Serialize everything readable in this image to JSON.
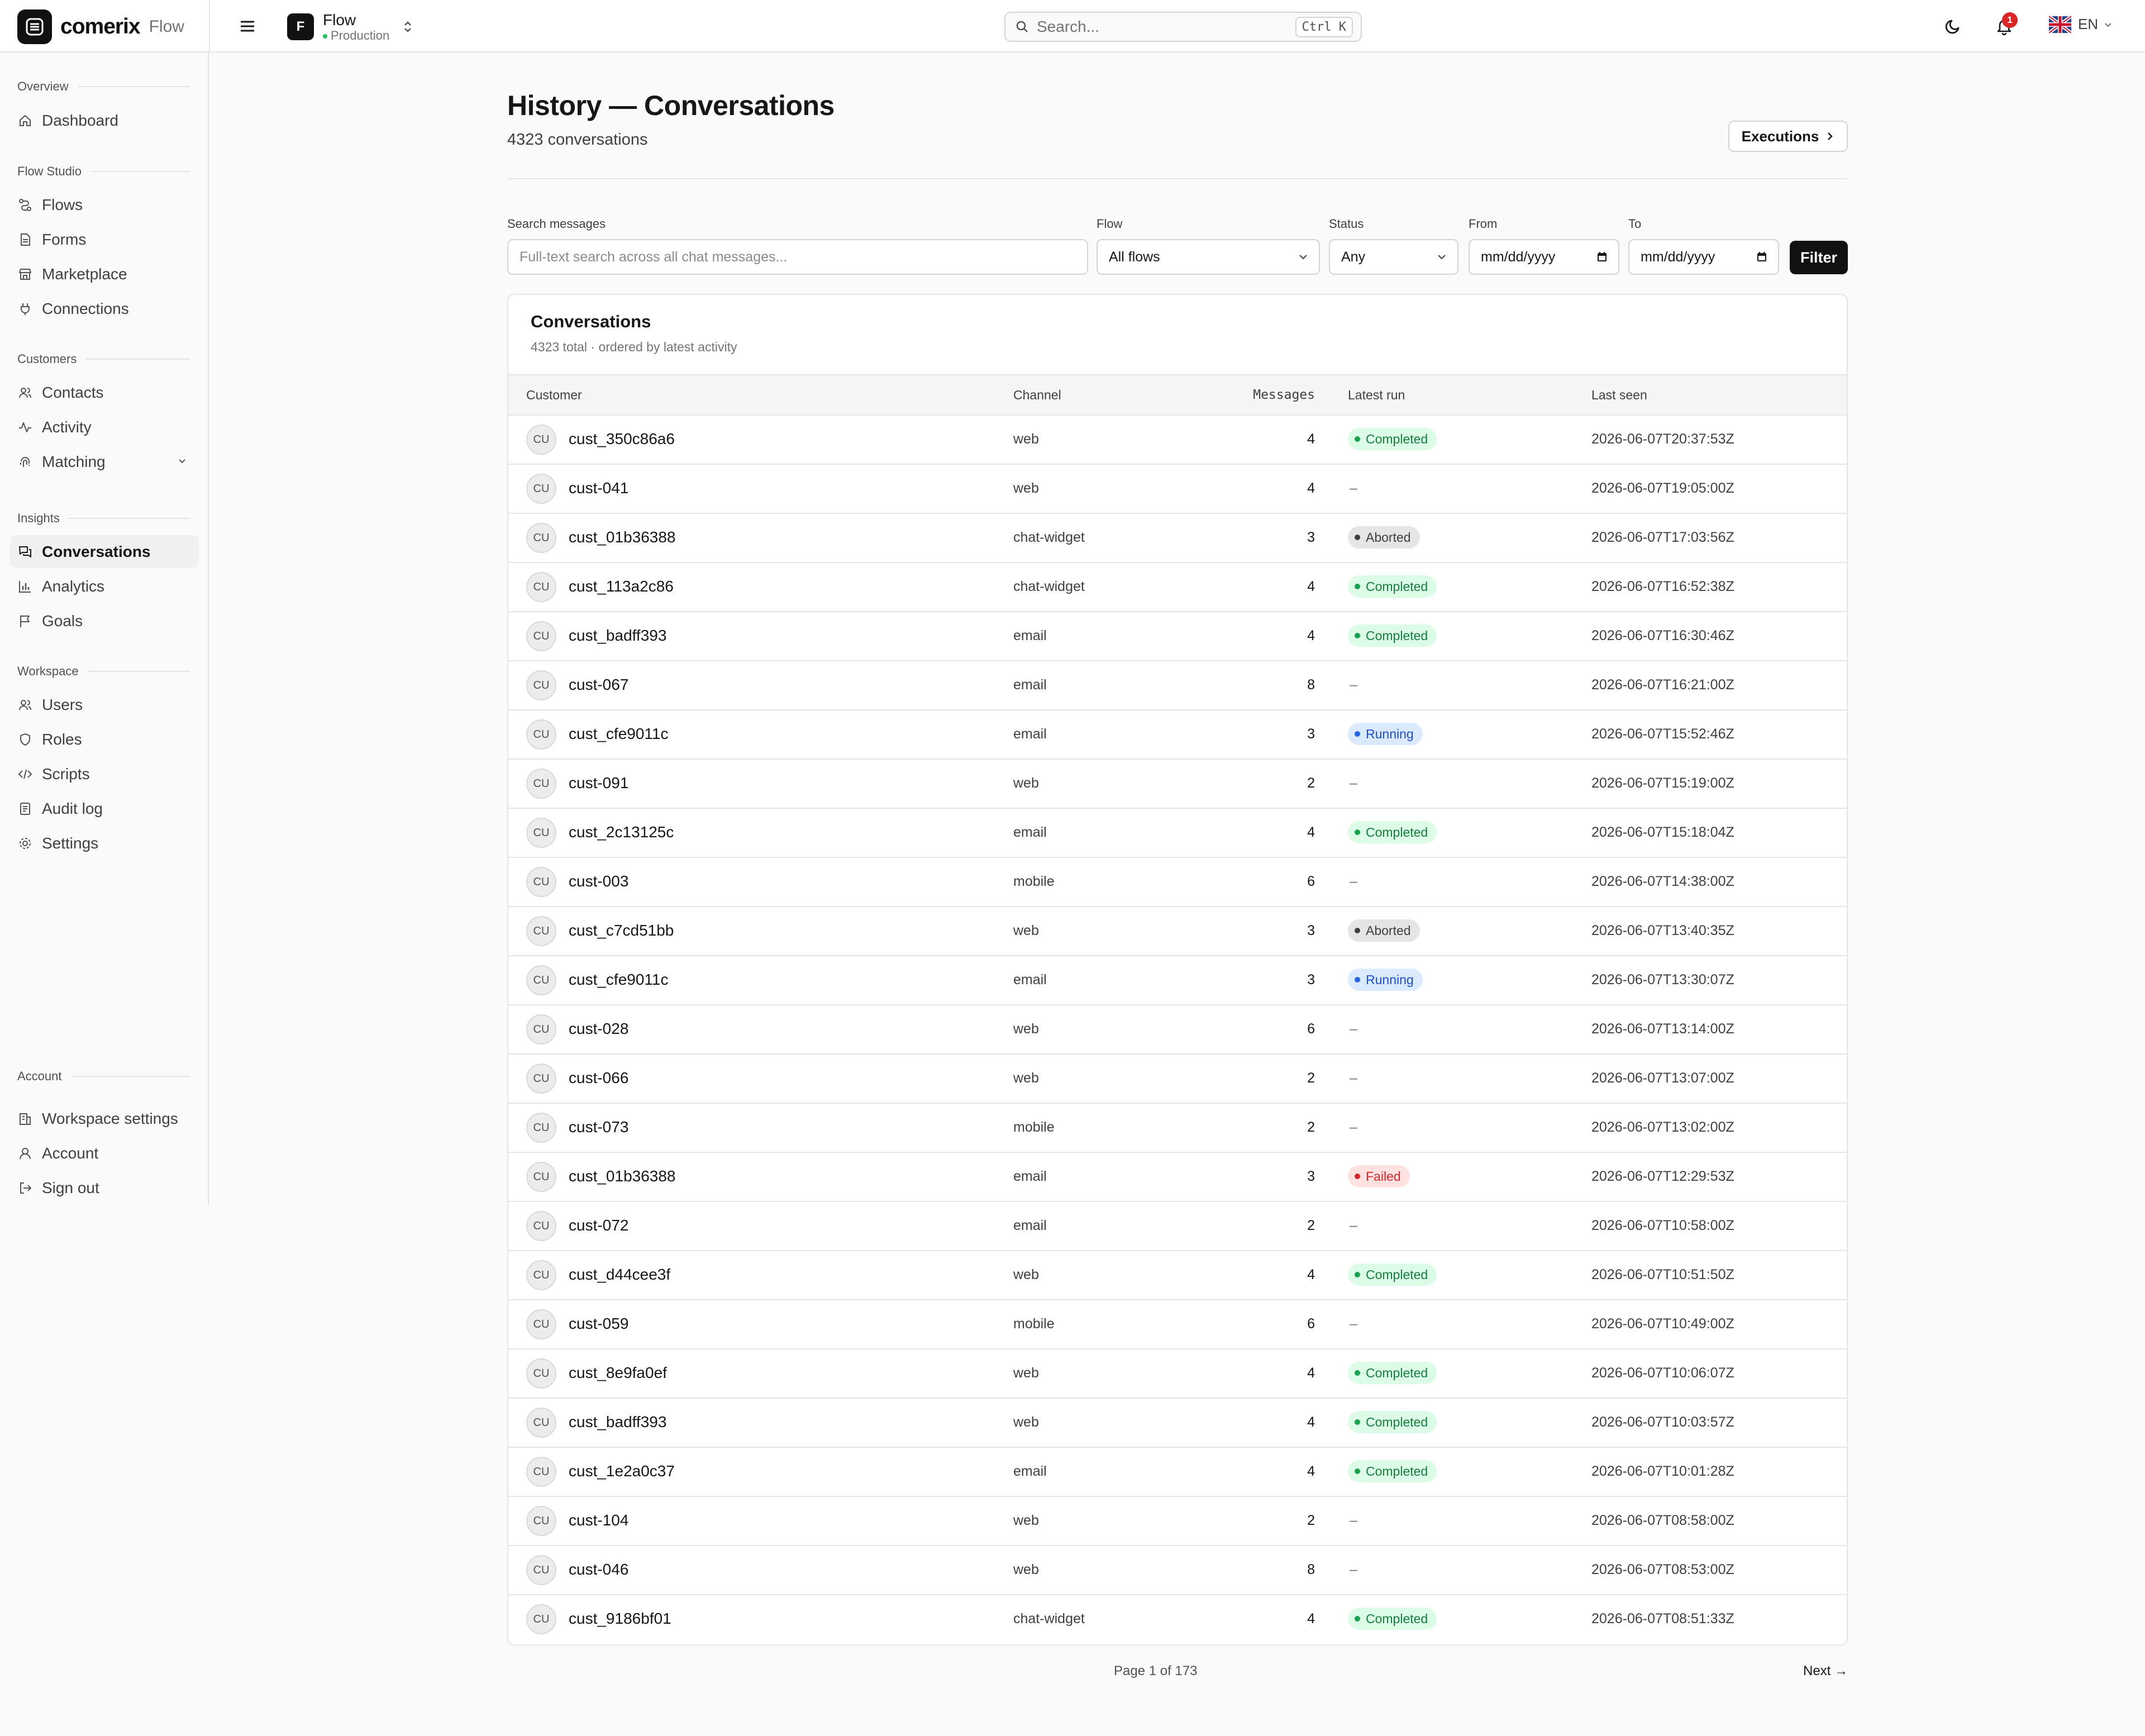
{
  "app": {
    "brand": "comerix",
    "product": "Flow"
  },
  "workspace": {
    "badge": "F",
    "name": "Flow",
    "env": "Production"
  },
  "search": {
    "placeholder": "Search...",
    "shortcut": "Ctrl K"
  },
  "notifications": {
    "count": "1"
  },
  "language": {
    "code": "EN"
  },
  "sidebar": {
    "sections": [
      {
        "title": "Overview",
        "items": [
          {
            "label": "Dashboard",
            "icon": "home-icon"
          }
        ]
      },
      {
        "title": "Flow Studio",
        "items": [
          {
            "label": "Flows",
            "icon": "flow-icon"
          },
          {
            "label": "Forms",
            "icon": "form-icon"
          },
          {
            "label": "Marketplace",
            "icon": "store-icon"
          },
          {
            "label": "Connections",
            "icon": "plug-icon"
          }
        ]
      },
      {
        "title": "Customers",
        "items": [
          {
            "label": "Contacts",
            "icon": "users-icon"
          },
          {
            "label": "Activity",
            "icon": "activity-icon"
          },
          {
            "label": "Matching",
            "icon": "fingerprint-icon"
          }
        ]
      },
      {
        "title": "Insights",
        "items": [
          {
            "label": "Conversations",
            "icon": "chat-icon",
            "active": true
          },
          {
            "label": "Analytics",
            "icon": "bar-chart-icon"
          },
          {
            "label": "Goals",
            "icon": "flag-icon"
          }
        ]
      },
      {
        "title": "Workspace",
        "items": [
          {
            "label": "Users",
            "icon": "users-icon"
          },
          {
            "label": "Roles",
            "icon": "shield-icon"
          },
          {
            "label": "Scripts",
            "icon": "code-icon"
          },
          {
            "label": "Audit log",
            "icon": "log-icon"
          },
          {
            "label": "Settings",
            "icon": "gear-icon"
          }
        ]
      },
      {
        "title": "Account",
        "items": [
          {
            "label": "Workspace settings",
            "icon": "building-icon"
          },
          {
            "label": "Account",
            "icon": "user-icon"
          },
          {
            "label": "Sign out",
            "icon": "logout-icon"
          }
        ]
      }
    ]
  },
  "page": {
    "title": "History — Conversations",
    "subtitle": "4323 conversations",
    "executions_button": "Executions"
  },
  "filters": {
    "search_label": "Search messages",
    "search_placeholder": "Full-text search across all chat messages...",
    "flow_label": "Flow",
    "flow_value": "All flows",
    "status_label": "Status",
    "status_value": "Any",
    "from_label": "From",
    "from_placeholder": "mm/dd/yyyy",
    "to_label": "To",
    "to_placeholder": "mm/dd/yyyy",
    "filter_button": "Filter"
  },
  "table": {
    "title": "Conversations",
    "subtitle": "4323 total · ordered by latest activity",
    "columns": [
      "Customer",
      "Channel",
      "Messages",
      "Latest run",
      "Last seen"
    ],
    "rows": [
      {
        "avatar": "CU",
        "customer": "cust_350c86a6",
        "channel": "web",
        "messages": "4",
        "run": "Completed",
        "seen": "2026-06-07T20:37:53Z"
      },
      {
        "avatar": "CU",
        "customer": "cust-041",
        "channel": "web",
        "messages": "4",
        "run": "–",
        "seen": "2026-06-07T19:05:00Z"
      },
      {
        "avatar": "CU",
        "customer": "cust_01b36388",
        "channel": "chat-widget",
        "messages": "3",
        "run": "Aborted",
        "seen": "2026-06-07T17:03:56Z"
      },
      {
        "avatar": "CU",
        "customer": "cust_113a2c86",
        "channel": "chat-widget",
        "messages": "4",
        "run": "Completed",
        "seen": "2026-06-07T16:52:38Z"
      },
      {
        "avatar": "CU",
        "customer": "cust_badff393",
        "channel": "email",
        "messages": "4",
        "run": "Completed",
        "seen": "2026-06-07T16:30:46Z"
      },
      {
        "avatar": "CU",
        "customer": "cust-067",
        "channel": "email",
        "messages": "8",
        "run": "–",
        "seen": "2026-06-07T16:21:00Z"
      },
      {
        "avatar": "CU",
        "customer": "cust_cfe9011c",
        "channel": "email",
        "messages": "3",
        "run": "Running",
        "seen": "2026-06-07T15:52:46Z"
      },
      {
        "avatar": "CU",
        "customer": "cust-091",
        "channel": "web",
        "messages": "2",
        "run": "–",
        "seen": "2026-06-07T15:19:00Z"
      },
      {
        "avatar": "CU",
        "customer": "cust_2c13125c",
        "channel": "email",
        "messages": "4",
        "run": "Completed",
        "seen": "2026-06-07T15:18:04Z"
      },
      {
        "avatar": "CU",
        "customer": "cust-003",
        "channel": "mobile",
        "messages": "6",
        "run": "–",
        "seen": "2026-06-07T14:38:00Z"
      },
      {
        "avatar": "CU",
        "customer": "cust_c7cd51bb",
        "channel": "web",
        "messages": "3",
        "run": "Aborted",
        "seen": "2026-06-07T13:40:35Z"
      },
      {
        "avatar": "CU",
        "customer": "cust_cfe9011c",
        "channel": "email",
        "messages": "3",
        "run": "Running",
        "seen": "2026-06-07T13:30:07Z"
      },
      {
        "avatar": "CU",
        "customer": "cust-028",
        "channel": "web",
        "messages": "6",
        "run": "–",
        "seen": "2026-06-07T13:14:00Z"
      },
      {
        "avatar": "CU",
        "customer": "cust-066",
        "channel": "web",
        "messages": "2",
        "run": "–",
        "seen": "2026-06-07T13:07:00Z"
      },
      {
        "avatar": "CU",
        "customer": "cust-073",
        "channel": "mobile",
        "messages": "2",
        "run": "–",
        "seen": "2026-06-07T13:02:00Z"
      },
      {
        "avatar": "CU",
        "customer": "cust_01b36388",
        "channel": "email",
        "messages": "3",
        "run": "Failed",
        "seen": "2026-06-07T12:29:53Z"
      },
      {
        "avatar": "CU",
        "customer": "cust-072",
        "channel": "email",
        "messages": "2",
        "run": "–",
        "seen": "2026-06-07T10:58:00Z"
      },
      {
        "avatar": "CU",
        "customer": "cust_d44cee3f",
        "channel": "web",
        "messages": "4",
        "run": "Completed",
        "seen": "2026-06-07T10:51:50Z"
      },
      {
        "avatar": "CU",
        "customer": "cust-059",
        "channel": "mobile",
        "messages": "6",
        "run": "–",
        "seen": "2026-06-07T10:49:00Z"
      },
      {
        "avatar": "CU",
        "customer": "cust_8e9fa0ef",
        "channel": "web",
        "messages": "4",
        "run": "Completed",
        "seen": "2026-06-07T10:06:07Z"
      },
      {
        "avatar": "CU",
        "customer": "cust_badff393",
        "channel": "web",
        "messages": "4",
        "run": "Completed",
        "seen": "2026-06-07T10:03:57Z"
      },
      {
        "avatar": "CU",
        "customer": "cust_1e2a0c37",
        "channel": "email",
        "messages": "4",
        "run": "Completed",
        "seen": "2026-06-07T10:01:28Z"
      },
      {
        "avatar": "CU",
        "customer": "cust-104",
        "channel": "web",
        "messages": "2",
        "run": "–",
        "seen": "2026-06-07T08:58:00Z"
      },
      {
        "avatar": "CU",
        "customer": "cust-046",
        "channel": "web",
        "messages": "8",
        "run": "–",
        "seen": "2026-06-07T08:53:00Z"
      },
      {
        "avatar": "CU",
        "customer": "cust_9186bf01",
        "channel": "chat-widget",
        "messages": "4",
        "run": "Completed",
        "seen": "2026-06-07T08:51:33Z"
      }
    ]
  },
  "pagination": {
    "label": "Page 1 of 173",
    "next": "Next →"
  },
  "colors": {
    "primary": "#111111",
    "completed": "#16a34a",
    "running": "#2563eb",
    "failed": "#dc2626",
    "aborted": "#404040"
  }
}
